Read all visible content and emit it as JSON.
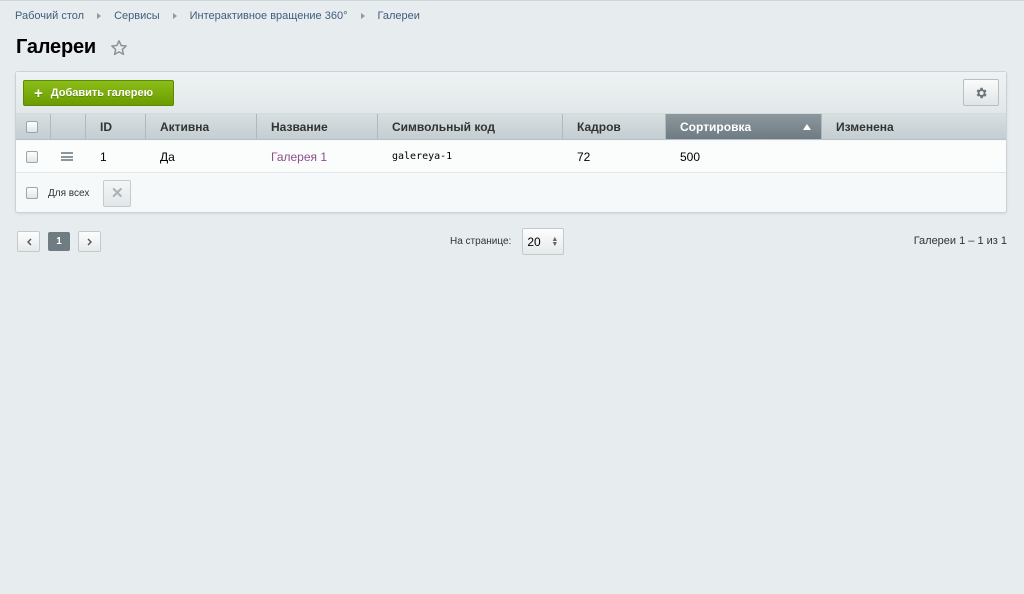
{
  "breadcrumb": [
    "Рабочий стол",
    "Сервисы",
    "Интерактивное вращение 360°",
    "Галереи"
  ],
  "page_title": "Галереи",
  "toolbar": {
    "add_label": "Добавить галерею"
  },
  "table": {
    "columns": [
      "ID",
      "Активна",
      "Название",
      "Символьный код",
      "Кадров",
      "Сортировка",
      "Изменена"
    ],
    "sorted_column": "Сортировка",
    "rows": [
      {
        "id": "1",
        "active": "Да",
        "name": "Галерея 1",
        "code": "galereya-1",
        "frames": "72",
        "sort": "500",
        "modified": ""
      }
    ]
  },
  "footer": {
    "for_all_label": "Для всех"
  },
  "pagination": {
    "current_page": "1",
    "per_page_label": "На странице:",
    "per_page_value": "20",
    "total_info": "Галереи 1 – 1 из 1"
  },
  "colors": {
    "accent_green": "#6b9c00",
    "link": "#8f4d8a",
    "background": "#e7ecee"
  }
}
